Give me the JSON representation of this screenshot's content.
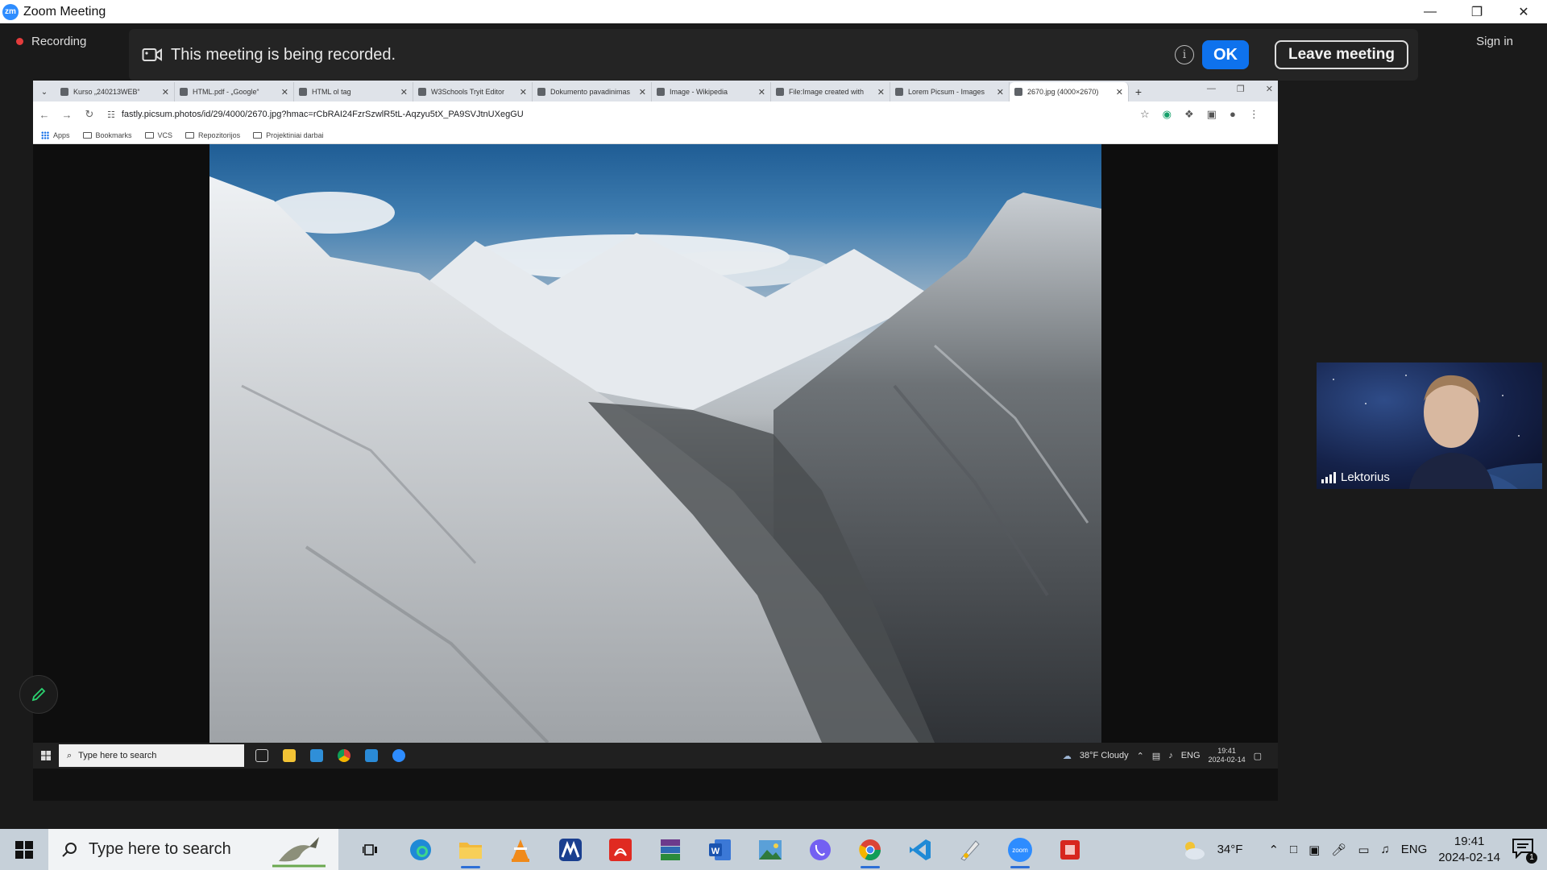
{
  "window": {
    "title": "Zoom Meeting",
    "logo_text": "zm"
  },
  "zoom": {
    "recording_label": "Recording",
    "sign_in": "Sign in",
    "banner": {
      "message": "This meeting is being recorded.",
      "ok_label": "OK",
      "leave_label": "Leave meeting"
    },
    "participant": {
      "name": "Lektorius"
    }
  },
  "shared_browser": {
    "tabs": [
      {
        "label": "Kurso „240213WEB“",
        "active": false
      },
      {
        "label": "HTML.pdf - „Google“",
        "active": false
      },
      {
        "label": "HTML ol tag",
        "active": false
      },
      {
        "label": "W3Schools Tryit Editor",
        "active": false
      },
      {
        "label": "Dokumento pavadinimas",
        "active": false
      },
      {
        "label": "Image - Wikipedia",
        "active": false
      },
      {
        "label": "File:Image created with",
        "active": false
      },
      {
        "label": "Lorem Picsum - Images",
        "active": false
      },
      {
        "label": "2670.jpg (4000×2670)",
        "active": true
      }
    ],
    "url": "fastly.picsum.photos/id/29/4000/2670.jpg?hmac=rCbRAI24FzrSzwlR5tL-Aqzyu5tX_PA9SVJtnUXegGU",
    "bookmarks": [
      "Apps",
      "Bookmarks",
      "VCS",
      "Repozitorijos",
      "Projektiniai darbai"
    ],
    "taskbar": {
      "search_placeholder": "Type here to search",
      "weather": "38°F  Cloudy",
      "lang": "ENG",
      "time": "19:41",
      "date": "2024-02-14"
    }
  },
  "taskbar": {
    "search_placeholder": "Type here to search",
    "weather_temp": "34°F",
    "lang": "ENG",
    "time": "19:41",
    "date": "2024-02-14",
    "notification_count": "1",
    "apps": [
      "task-view",
      "edge",
      "file-explorer",
      "vlc",
      "app-m",
      "acrobat",
      "winrar",
      "word",
      "photos",
      "viber",
      "chrome",
      "vscode",
      "paint",
      "zoom",
      "app-red"
    ]
  }
}
